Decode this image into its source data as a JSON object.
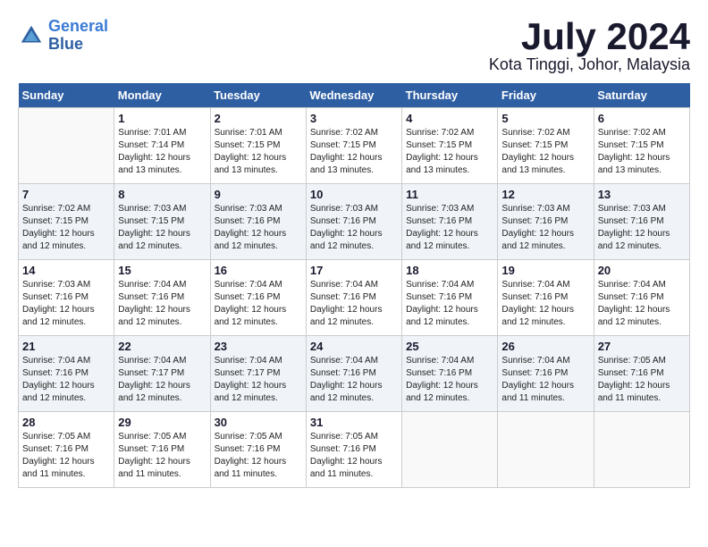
{
  "header": {
    "logo_line1": "General",
    "logo_line2": "Blue",
    "month": "July 2024",
    "location": "Kota Tinggi, Johor, Malaysia"
  },
  "weekdays": [
    "Sunday",
    "Monday",
    "Tuesday",
    "Wednesday",
    "Thursday",
    "Friday",
    "Saturday"
  ],
  "weeks": [
    [
      {
        "day": "",
        "info": ""
      },
      {
        "day": "1",
        "info": "Sunrise: 7:01 AM\nSunset: 7:14 PM\nDaylight: 12 hours\nand 13 minutes."
      },
      {
        "day": "2",
        "info": "Sunrise: 7:01 AM\nSunset: 7:15 PM\nDaylight: 12 hours\nand 13 minutes."
      },
      {
        "day": "3",
        "info": "Sunrise: 7:02 AM\nSunset: 7:15 PM\nDaylight: 12 hours\nand 13 minutes."
      },
      {
        "day": "4",
        "info": "Sunrise: 7:02 AM\nSunset: 7:15 PM\nDaylight: 12 hours\nand 13 minutes."
      },
      {
        "day": "5",
        "info": "Sunrise: 7:02 AM\nSunset: 7:15 PM\nDaylight: 12 hours\nand 13 minutes."
      },
      {
        "day": "6",
        "info": "Sunrise: 7:02 AM\nSunset: 7:15 PM\nDaylight: 12 hours\nand 13 minutes."
      }
    ],
    [
      {
        "day": "7",
        "info": "Sunrise: 7:02 AM\nSunset: 7:15 PM\nDaylight: 12 hours\nand 12 minutes."
      },
      {
        "day": "8",
        "info": "Sunrise: 7:03 AM\nSunset: 7:15 PM\nDaylight: 12 hours\nand 12 minutes."
      },
      {
        "day": "9",
        "info": "Sunrise: 7:03 AM\nSunset: 7:16 PM\nDaylight: 12 hours\nand 12 minutes."
      },
      {
        "day": "10",
        "info": "Sunrise: 7:03 AM\nSunset: 7:16 PM\nDaylight: 12 hours\nand 12 minutes."
      },
      {
        "day": "11",
        "info": "Sunrise: 7:03 AM\nSunset: 7:16 PM\nDaylight: 12 hours\nand 12 minutes."
      },
      {
        "day": "12",
        "info": "Sunrise: 7:03 AM\nSunset: 7:16 PM\nDaylight: 12 hours\nand 12 minutes."
      },
      {
        "day": "13",
        "info": "Sunrise: 7:03 AM\nSunset: 7:16 PM\nDaylight: 12 hours\nand 12 minutes."
      }
    ],
    [
      {
        "day": "14",
        "info": "Sunrise: 7:03 AM\nSunset: 7:16 PM\nDaylight: 12 hours\nand 12 minutes."
      },
      {
        "day": "15",
        "info": "Sunrise: 7:04 AM\nSunset: 7:16 PM\nDaylight: 12 hours\nand 12 minutes."
      },
      {
        "day": "16",
        "info": "Sunrise: 7:04 AM\nSunset: 7:16 PM\nDaylight: 12 hours\nand 12 minutes."
      },
      {
        "day": "17",
        "info": "Sunrise: 7:04 AM\nSunset: 7:16 PM\nDaylight: 12 hours\nand 12 minutes."
      },
      {
        "day": "18",
        "info": "Sunrise: 7:04 AM\nSunset: 7:16 PM\nDaylight: 12 hours\nand 12 minutes."
      },
      {
        "day": "19",
        "info": "Sunrise: 7:04 AM\nSunset: 7:16 PM\nDaylight: 12 hours\nand 12 minutes."
      },
      {
        "day": "20",
        "info": "Sunrise: 7:04 AM\nSunset: 7:16 PM\nDaylight: 12 hours\nand 12 minutes."
      }
    ],
    [
      {
        "day": "21",
        "info": "Sunrise: 7:04 AM\nSunset: 7:16 PM\nDaylight: 12 hours\nand 12 minutes."
      },
      {
        "day": "22",
        "info": "Sunrise: 7:04 AM\nSunset: 7:17 PM\nDaylight: 12 hours\nand 12 minutes."
      },
      {
        "day": "23",
        "info": "Sunrise: 7:04 AM\nSunset: 7:17 PM\nDaylight: 12 hours\nand 12 minutes."
      },
      {
        "day": "24",
        "info": "Sunrise: 7:04 AM\nSunset: 7:16 PM\nDaylight: 12 hours\nand 12 minutes."
      },
      {
        "day": "25",
        "info": "Sunrise: 7:04 AM\nSunset: 7:16 PM\nDaylight: 12 hours\nand 12 minutes."
      },
      {
        "day": "26",
        "info": "Sunrise: 7:04 AM\nSunset: 7:16 PM\nDaylight: 12 hours\nand 11 minutes."
      },
      {
        "day": "27",
        "info": "Sunrise: 7:05 AM\nSunset: 7:16 PM\nDaylight: 12 hours\nand 11 minutes."
      }
    ],
    [
      {
        "day": "28",
        "info": "Sunrise: 7:05 AM\nSunset: 7:16 PM\nDaylight: 12 hours\nand 11 minutes."
      },
      {
        "day": "29",
        "info": "Sunrise: 7:05 AM\nSunset: 7:16 PM\nDaylight: 12 hours\nand 11 minutes."
      },
      {
        "day": "30",
        "info": "Sunrise: 7:05 AM\nSunset: 7:16 PM\nDaylight: 12 hours\nand 11 minutes."
      },
      {
        "day": "31",
        "info": "Sunrise: 7:05 AM\nSunset: 7:16 PM\nDaylight: 12 hours\nand 11 minutes."
      },
      {
        "day": "",
        "info": ""
      },
      {
        "day": "",
        "info": ""
      },
      {
        "day": "",
        "info": ""
      }
    ]
  ]
}
